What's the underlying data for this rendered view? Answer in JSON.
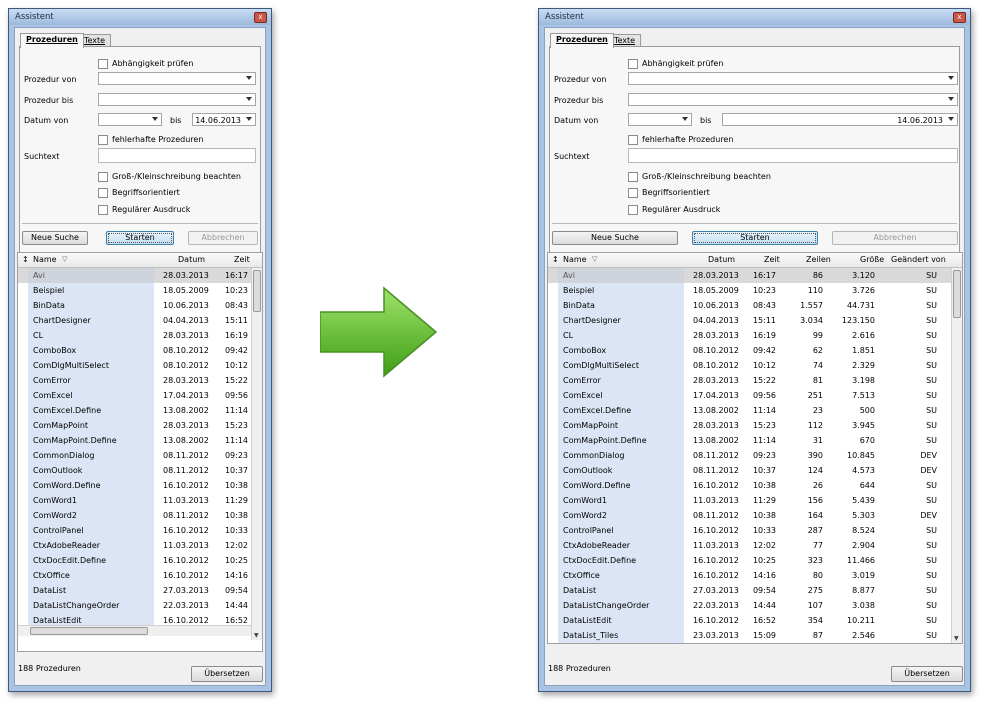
{
  "window": {
    "title": "Assistent",
    "close_glyph": "x"
  },
  "tabs": [
    {
      "label": "Prozeduren"
    },
    {
      "label": "Texte"
    }
  ],
  "form": {
    "dependency_check": "Abhängigkeit prüfen",
    "proc_from_label": "Prozedur von",
    "proc_to_label": "Prozedur bis",
    "date_from_label": "Datum von",
    "date_to_label": "bis",
    "date_to_value": "14.06.2013",
    "faulty_label": "fehlerhafte Prozeduren",
    "search_label": "Suchtext",
    "case_label": "Groß-/Kleinschreibung beachten",
    "term_label": "Begriffsorientiert",
    "regex_label": "Regulärer Ausdruck"
  },
  "buttons": {
    "new_search": "Neue Suche",
    "start": "Starten",
    "cancel": "Abbrechen",
    "translate": "Übersetzen"
  },
  "columns": {
    "sort": "↕",
    "name": "Name",
    "sort_indicator": "▽",
    "date": "Datum",
    "time": "Zeit",
    "lines": "Zeilen",
    "size": "Größe",
    "changed_by": "Geändert von"
  },
  "rows_left": [
    {
      "name": "Avi",
      "date": "28.03.2013",
      "time": "16:17"
    },
    {
      "name": "Beispiel",
      "date": "18.05.2009",
      "time": "10:23"
    },
    {
      "name": "BinData",
      "date": "10.06.2013",
      "time": "08:43"
    },
    {
      "name": "ChartDesigner",
      "date": "04.04.2013",
      "time": "15:11"
    },
    {
      "name": "CL",
      "date": "28.03.2013",
      "time": "16:19"
    },
    {
      "name": "ComboBox",
      "date": "08.10.2012",
      "time": "09:42"
    },
    {
      "name": "ComDlgMultiSelect",
      "date": "08.10.2012",
      "time": "10:12"
    },
    {
      "name": "ComError",
      "date": "28.03.2013",
      "time": "15:22"
    },
    {
      "name": "ComExcel",
      "date": "17.04.2013",
      "time": "09:56"
    },
    {
      "name": "ComExcel.Define",
      "date": "13.08.2002",
      "time": "11:14"
    },
    {
      "name": "ComMapPoint",
      "date": "28.03.2013",
      "time": "15:23"
    },
    {
      "name": "ComMapPoint.Define",
      "date": "13.08.2002",
      "time": "11:14"
    },
    {
      "name": "CommonDialog",
      "date": "08.11.2012",
      "time": "09:23"
    },
    {
      "name": "ComOutlook",
      "date": "08.11.2012",
      "time": "10:37"
    },
    {
      "name": "ComWord.Define",
      "date": "16.10.2012",
      "time": "10:38"
    },
    {
      "name": "ComWord1",
      "date": "11.03.2013",
      "time": "11:29"
    },
    {
      "name": "ComWord2",
      "date": "08.11.2012",
      "time": "10:38"
    },
    {
      "name": "ControlPanel",
      "date": "16.10.2012",
      "time": "10:33"
    },
    {
      "name": "CtxAdobeReader",
      "date": "11.03.2013",
      "time": "12:02"
    },
    {
      "name": "CtxDocEdit.Define",
      "date": "16.10.2012",
      "time": "10:25"
    },
    {
      "name": "CtxOffice",
      "date": "16.10.2012",
      "time": "14:16"
    },
    {
      "name": "DataList",
      "date": "27.03.2013",
      "time": "09:54"
    },
    {
      "name": "DataListChangeOrder",
      "date": "22.03.2013",
      "time": "14:44"
    },
    {
      "name": "DataListEdit",
      "date": "16.10.2012",
      "time": "16:52"
    }
  ],
  "rows_right": [
    {
      "name": "Avi",
      "date": "28.03.2013",
      "time": "16:17",
      "lines": "86",
      "size": "3.120",
      "by": "SU"
    },
    {
      "name": "Beispiel",
      "date": "18.05.2009",
      "time": "10:23",
      "lines": "110",
      "size": "3.726",
      "by": "SU"
    },
    {
      "name": "BinData",
      "date": "10.06.2013",
      "time": "08:43",
      "lines": "1.557",
      "size": "44.731",
      "by": "SU"
    },
    {
      "name": "ChartDesigner",
      "date": "04.04.2013",
      "time": "15:11",
      "lines": "3.034",
      "size": "123.150",
      "by": "SU"
    },
    {
      "name": "CL",
      "date": "28.03.2013",
      "time": "16:19",
      "lines": "99",
      "size": "2.616",
      "by": "SU"
    },
    {
      "name": "ComboBox",
      "date": "08.10.2012",
      "time": "09:42",
      "lines": "62",
      "size": "1.851",
      "by": "SU"
    },
    {
      "name": "ComDlgMultiSelect",
      "date": "08.10.2012",
      "time": "10:12",
      "lines": "74",
      "size": "2.329",
      "by": "SU"
    },
    {
      "name": "ComError",
      "date": "28.03.2013",
      "time": "15:22",
      "lines": "81",
      "size": "3.198",
      "by": "SU"
    },
    {
      "name": "ComExcel",
      "date": "17.04.2013",
      "time": "09:56",
      "lines": "251",
      "size": "7.513",
      "by": "SU"
    },
    {
      "name": "ComExcel.Define",
      "date": "13.08.2002",
      "time": "11:14",
      "lines": "23",
      "size": "500",
      "by": "SU"
    },
    {
      "name": "ComMapPoint",
      "date": "28.03.2013",
      "time": "15:23",
      "lines": "112",
      "size": "3.945",
      "by": "SU"
    },
    {
      "name": "ComMapPoint.Define",
      "date": "13.08.2002",
      "time": "11:14",
      "lines": "31",
      "size": "670",
      "by": "SU"
    },
    {
      "name": "CommonDialog",
      "date": "08.11.2012",
      "time": "09:23",
      "lines": "390",
      "size": "10.845",
      "by": "DEV"
    },
    {
      "name": "ComOutlook",
      "date": "08.11.2012",
      "time": "10:37",
      "lines": "124",
      "size": "4.573",
      "by": "DEV"
    },
    {
      "name": "ComWord.Define",
      "date": "16.10.2012",
      "time": "10:38",
      "lines": "26",
      "size": "644",
      "by": "SU"
    },
    {
      "name": "ComWord1",
      "date": "11.03.2013",
      "time": "11:29",
      "lines": "156",
      "size": "5.439",
      "by": "SU"
    },
    {
      "name": "ComWord2",
      "date": "08.11.2012",
      "time": "10:38",
      "lines": "164",
      "size": "5.303",
      "by": "DEV"
    },
    {
      "name": "ControlPanel",
      "date": "16.10.2012",
      "time": "10:33",
      "lines": "287",
      "size": "8.524",
      "by": "SU"
    },
    {
      "name": "CtxAdobeReader",
      "date": "11.03.2013",
      "time": "12:02",
      "lines": "77",
      "size": "2.904",
      "by": "SU"
    },
    {
      "name": "CtxDocEdit.Define",
      "date": "16.10.2012",
      "time": "10:25",
      "lines": "323",
      "size": "11.466",
      "by": "SU"
    },
    {
      "name": "CtxOffice",
      "date": "16.10.2012",
      "time": "14:16",
      "lines": "80",
      "size": "3.019",
      "by": "SU"
    },
    {
      "name": "DataList",
      "date": "27.03.2013",
      "time": "09:54",
      "lines": "275",
      "size": "8.877",
      "by": "SU"
    },
    {
      "name": "DataListChangeOrder",
      "date": "22.03.2013",
      "time": "14:44",
      "lines": "107",
      "size": "3.038",
      "by": "SU"
    },
    {
      "name": "DataListEdit",
      "date": "16.10.2012",
      "time": "16:52",
      "lines": "354",
      "size": "10.211",
      "by": "SU"
    },
    {
      "name": "DataList_Tiles",
      "date": "23.03.2013",
      "time": "15:09",
      "lines": "87",
      "size": "2.546",
      "by": "SU"
    }
  ],
  "status": {
    "count": "188 Prozeduren"
  },
  "colors": {
    "arrow": "#5cc12a",
    "name_column": "#dce5f5",
    "selected_row": "#d9d9d9",
    "window_frame": "#a9c3e2"
  },
  "icons": {
    "arrow": "right-arrow-icon",
    "close": "close-icon",
    "chevron": "chevron-down-icon"
  }
}
